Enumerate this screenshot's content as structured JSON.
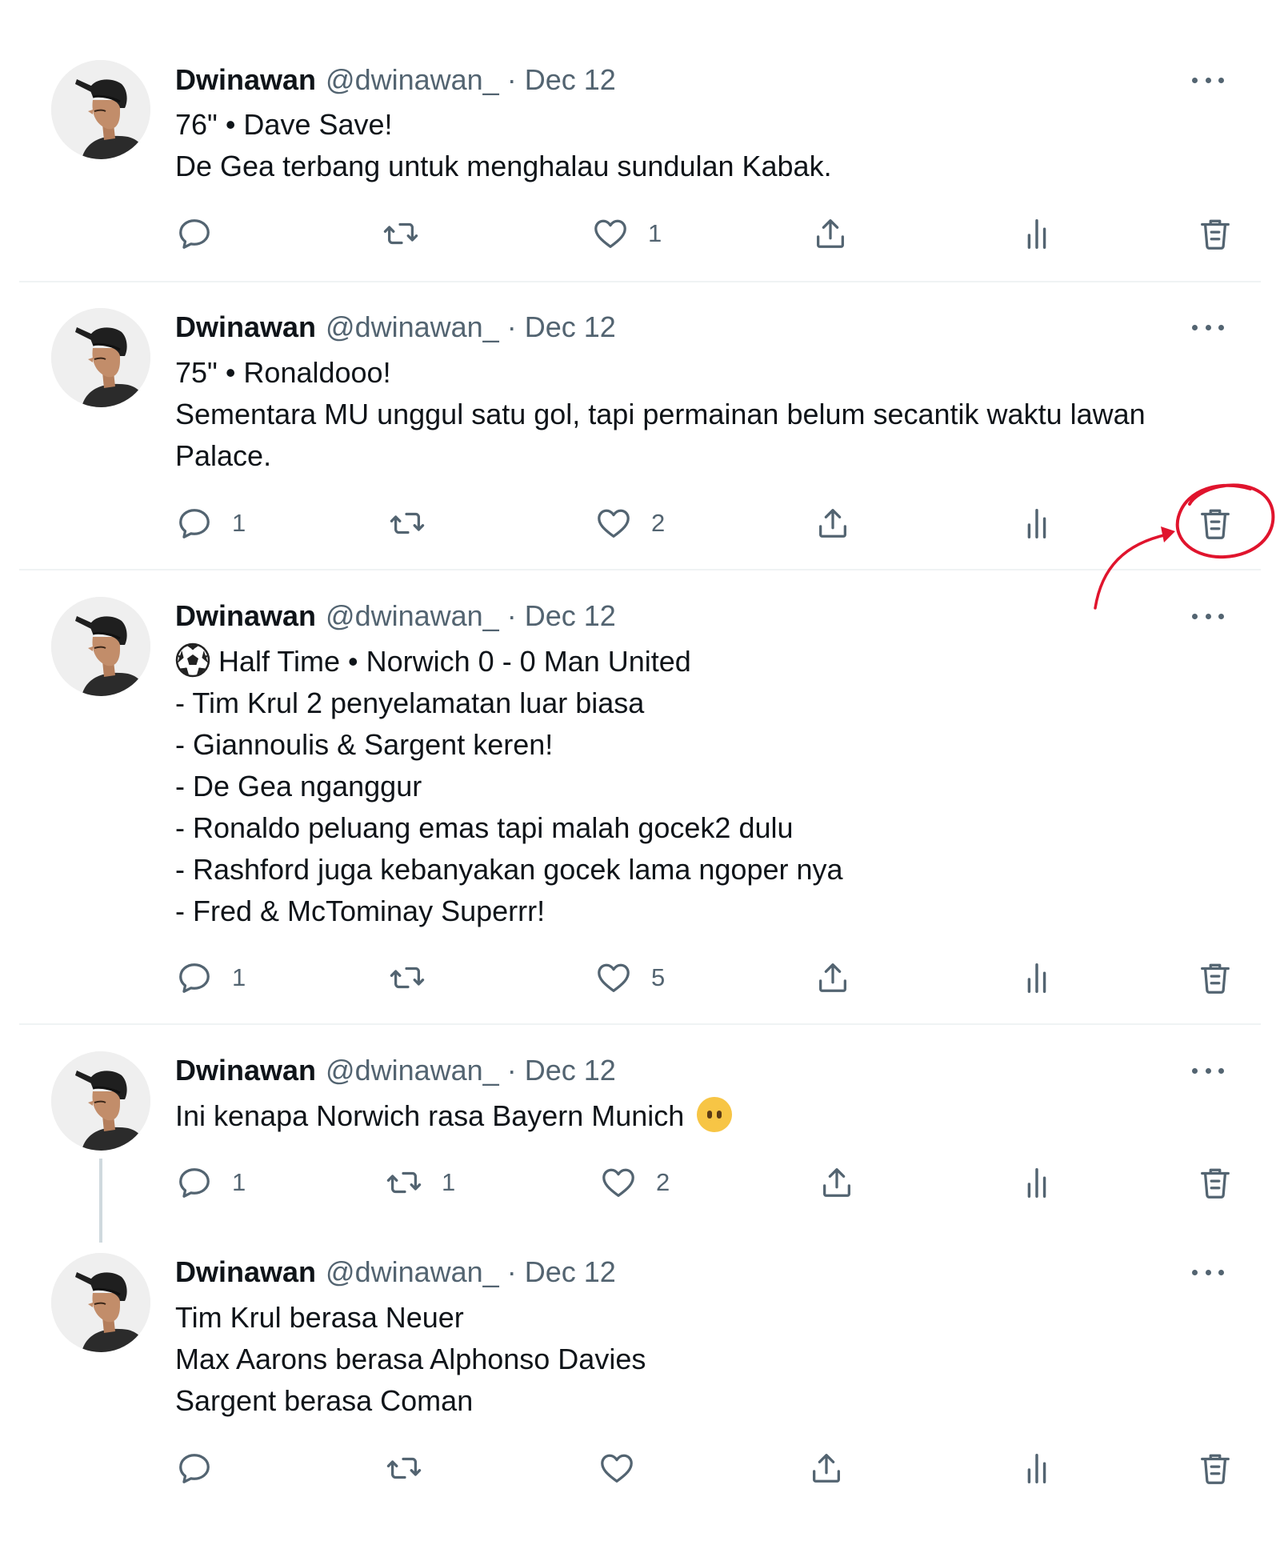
{
  "tweets": [
    {
      "name": "Dwinawan",
      "handle": "@dwinawan_",
      "separator": "·",
      "date": "Dec 12",
      "lines": [
        "76\" • Dave Save!",
        "De Gea terbang untuk menghalau sundulan Kabak."
      ],
      "counts": {
        "reply": "",
        "retweet": "",
        "like": "1"
      }
    },
    {
      "name": "Dwinawan",
      "handle": "@dwinawan_",
      "separator": "·",
      "date": "Dec 12",
      "lines": [
        "75\" • Ronaldooo!",
        "Sementara MU unggul satu gol, tapi permainan belum secantik waktu lawan",
        "Palace."
      ],
      "counts": {
        "reply": "1",
        "retweet": "",
        "like": "2"
      }
    },
    {
      "name": "Dwinawan",
      "handle": "@dwinawan_",
      "separator": "·",
      "date": "Dec 12",
      "lines": [
        "Half Time • Norwich 0 - 0 Man United",
        "- Tim Krul 2 penyelamatan luar biasa",
        "- Giannoulis & Sargent keren!",
        "- De Gea nganggur",
        "- Ronaldo peluang emas tapi malah gocek2 dulu",
        "- Rashford juga kebanyakan gocek lama ngoper nya",
        "- Fred & McTominay Superrr!"
      ],
      "counts": {
        "reply": "1",
        "retweet": "",
        "like": "5"
      }
    },
    {
      "name": "Dwinawan",
      "handle": "@dwinawan_",
      "separator": "·",
      "date": "Dec 12",
      "lines": [
        "Ini kenapa Norwich rasa Bayern Munich"
      ],
      "counts": {
        "reply": "1",
        "retweet": "1",
        "like": "2"
      }
    },
    {
      "name": "Dwinawan",
      "handle": "@dwinawan_",
      "separator": "·",
      "date": "Dec 12",
      "lines": [
        "Tim Krul berasa Neuer",
        "Max Aarons berasa Alphonso Davies",
        "Sargent berasa Coman"
      ],
      "counts": {
        "reply": "",
        "retweet": "",
        "like": ""
      }
    }
  ],
  "icons": {
    "reply": "reply-icon",
    "retweet": "retweet-icon",
    "like": "heart-icon",
    "share": "share-icon",
    "analytics": "analytics-icon",
    "delete": "trash-icon",
    "more": "more-icon",
    "half_time_emoji": "soccer-ball-icon",
    "face_emoji": "face-without-mouth-icon"
  },
  "colors": {
    "text_primary": "#0f1419",
    "text_secondary": "#536471",
    "divider": "#eff3f4",
    "annotation": "#e0142d"
  },
  "annotation": {
    "highlights": "delete-button on tweet 2"
  }
}
